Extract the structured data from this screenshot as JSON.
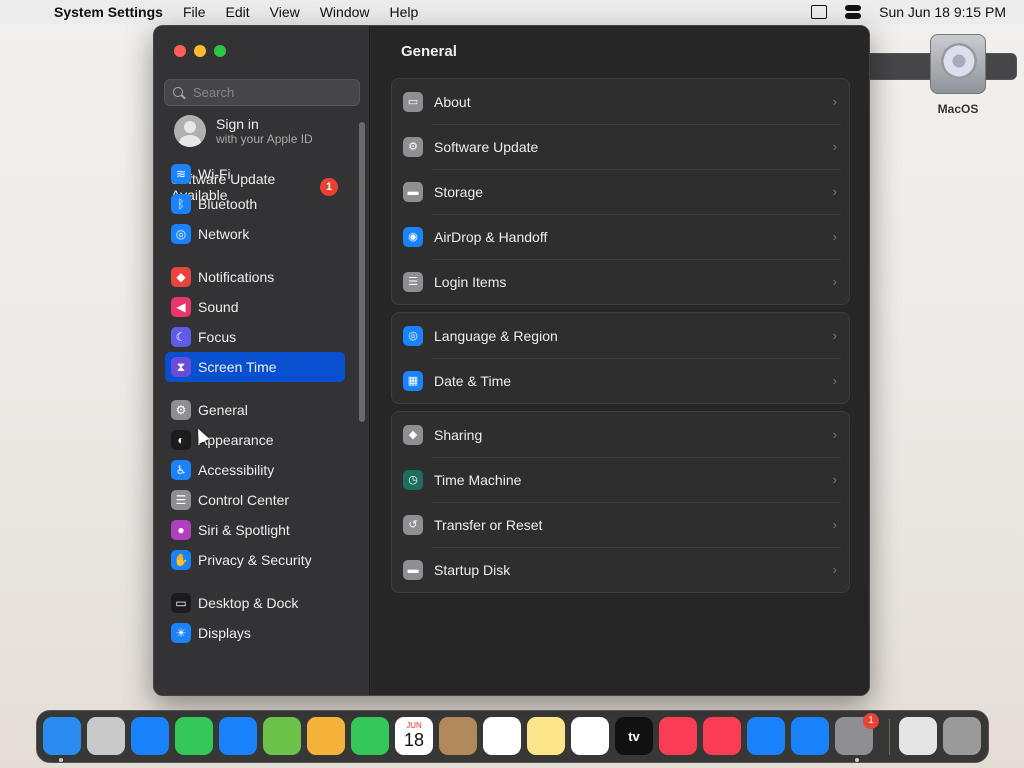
{
  "menubar": {
    "app_name": "System Settings",
    "menus": [
      "File",
      "Edit",
      "View",
      "Window",
      "Help"
    ],
    "clock": "Sun Jun 18  9:15 PM"
  },
  "desktop": {
    "disk_label": "MacOS"
  },
  "sidebar": {
    "search_placeholder": "Search",
    "signin_title": "Sign in",
    "signin_subtitle": "with your Apple ID",
    "update_line1": "Software Update",
    "update_line2": "Available",
    "update_badge": "1",
    "items": [
      {
        "label": "Wi-Fi",
        "icon": "wifi-icon",
        "color": "#1a82fb"
      },
      {
        "label": "Bluetooth",
        "icon": "bluetooth-icon",
        "color": "#1a82fb"
      },
      {
        "label": "Network",
        "icon": "globe-icon",
        "color": "#1a82fb"
      },
      {
        "label": "Notifications",
        "icon": "bell-icon",
        "color": "#e8453c"
      },
      {
        "label": "Sound",
        "icon": "speaker-icon",
        "color": "#e8356c"
      },
      {
        "label": "Focus",
        "icon": "moon-icon",
        "color": "#5e5ce6"
      },
      {
        "label": "Screen Time",
        "icon": "hourglass-icon",
        "color": "#6a4cd8"
      },
      {
        "label": "General",
        "icon": "gear-icon",
        "color": "#8e8e93"
      },
      {
        "label": "Appearance",
        "icon": "appearance-icon",
        "color": "#1c1c1e"
      },
      {
        "label": "Accessibility",
        "icon": "accessibility-icon",
        "color": "#1a82fb"
      },
      {
        "label": "Control Center",
        "icon": "control-center-icon",
        "color": "#8e8e93"
      },
      {
        "label": "Siri & Spotlight",
        "icon": "siri-icon",
        "color": "#b040c0"
      },
      {
        "label": "Privacy & Security",
        "icon": "hand-icon",
        "color": "#1a82fb"
      },
      {
        "label": "Desktop & Dock",
        "icon": "dock-icon",
        "color": "#1c1c1e"
      },
      {
        "label": "Displays",
        "icon": "display-icon",
        "color": "#1a82fb"
      }
    ]
  },
  "main": {
    "title": "General",
    "groups": [
      [
        {
          "label": "About",
          "icon": "monitor-icon",
          "color": "#8e8e93"
        },
        {
          "label": "Software Update",
          "icon": "gear-badge-icon",
          "color": "#8e8e93"
        },
        {
          "label": "Storage",
          "icon": "drive-icon",
          "color": "#8e8e93"
        },
        {
          "label": "AirDrop & Handoff",
          "icon": "airdrop-icon",
          "color": "#1a82fb"
        },
        {
          "label": "Login Items",
          "icon": "list-icon",
          "color": "#8e8e93"
        }
      ],
      [
        {
          "label": "Language & Region",
          "icon": "globe-icon",
          "color": "#1a82fb"
        },
        {
          "label": "Date & Time",
          "icon": "calendar-icon",
          "color": "#1a82fb"
        }
      ],
      [
        {
          "label": "Sharing",
          "icon": "sharing-icon",
          "color": "#8e8e93"
        },
        {
          "label": "Time Machine",
          "icon": "time-machine-icon",
          "color": "#1e6e60"
        },
        {
          "label": "Transfer or Reset",
          "icon": "reset-icon",
          "color": "#8e8e93"
        },
        {
          "label": "Startup Disk",
          "icon": "disk-icon",
          "color": "#8e8e93"
        }
      ]
    ]
  },
  "dock": {
    "apps": [
      {
        "name": "finder-icon",
        "color": "#2a8cf0"
      },
      {
        "name": "launchpad-icon",
        "color": "#c9c9c9"
      },
      {
        "name": "safari-icon",
        "color": "#1a82fb"
      },
      {
        "name": "messages-icon",
        "color": "#34c759"
      },
      {
        "name": "mail-icon",
        "color": "#1a82fb"
      },
      {
        "name": "maps-icon",
        "color": "#6cc24a"
      },
      {
        "name": "photos-icon",
        "color": "#f5b33b"
      },
      {
        "name": "facetime-icon",
        "color": "#34c759"
      },
      {
        "name": "calendar-icon",
        "color": "#ffffff"
      },
      {
        "name": "contacts-icon",
        "color": "#b08a5a"
      },
      {
        "name": "reminders-icon",
        "color": "#ffffff"
      },
      {
        "name": "notes-icon",
        "color": "#fde68a"
      },
      {
        "name": "freeform-icon",
        "color": "#ffffff"
      },
      {
        "name": "tv-icon",
        "color": "#111111"
      },
      {
        "name": "music-icon",
        "color": "#fa3d55"
      },
      {
        "name": "news-icon",
        "color": "#fa3d55"
      },
      {
        "name": "keynote-icon",
        "color": "#1a82fb"
      },
      {
        "name": "app-store-icon",
        "color": "#1a82fb"
      },
      {
        "name": "system-settings-icon",
        "color": "#8e8e93"
      },
      {
        "name": "archive-icon",
        "color": "#e5e5e5"
      },
      {
        "name": "trash-icon",
        "color": "#9a9a9a"
      }
    ],
    "calendar_month": "JUN",
    "calendar_day": "18",
    "tv_label": "tv",
    "settings_badge": "1"
  }
}
